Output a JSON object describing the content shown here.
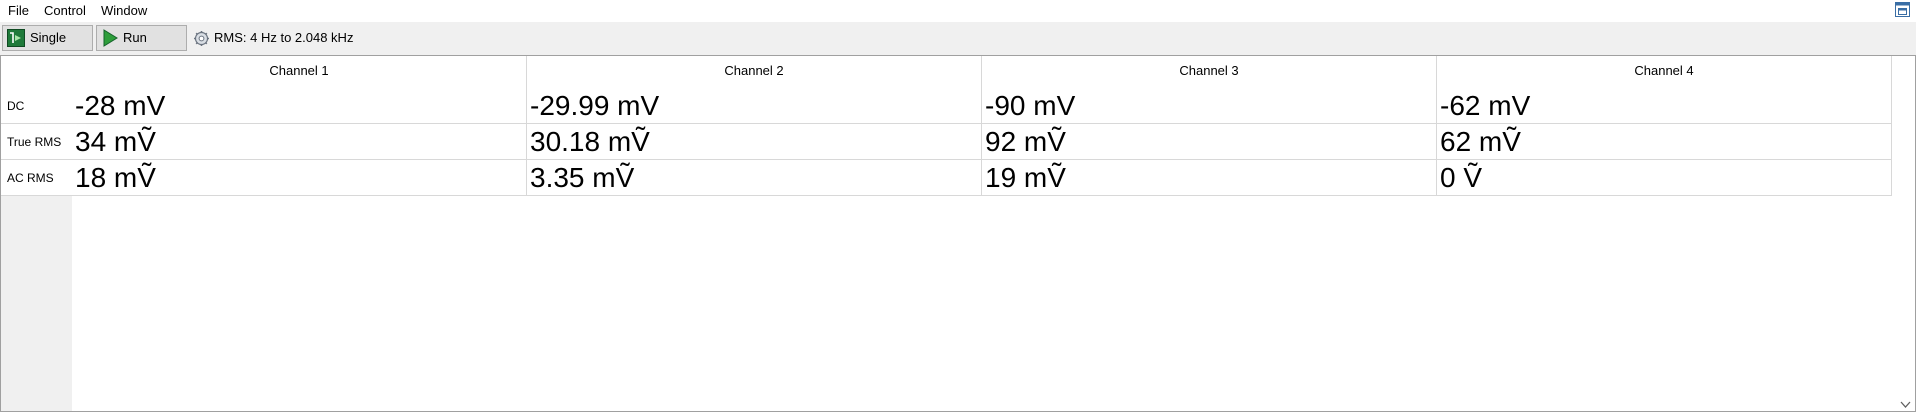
{
  "menu": {
    "file": "File",
    "control": "Control",
    "window": "Window"
  },
  "toolbar": {
    "single_label": "Single",
    "run_label": "Run",
    "rms_range": "RMS: 4 Hz to 2.048 kHz"
  },
  "icons": {
    "restore": "restore-window-icon",
    "single": "single-capture-icon",
    "run": "play-icon",
    "rms": "gear-icon",
    "scroll_down": "chevron-down-icon"
  },
  "colors": {
    "run_accent": "#2e9e3b",
    "single_accent": "#1f7a3a"
  },
  "table": {
    "columns": [
      "Channel 1",
      "Channel 2",
      "Channel 3",
      "Channel 4"
    ],
    "rows": [
      {
        "label": "DC",
        "values": [
          "-28 mV",
          "-29.99 mV",
          "-90 mV",
          "-62 mV"
        ]
      },
      {
        "label": "True RMS",
        "values": [
          "34 mṼ",
          "30.18 mṼ",
          "92 mṼ",
          "62 mṼ"
        ]
      },
      {
        "label": "AC RMS",
        "values": [
          "18 mṼ",
          "3.35 mṼ",
          "19 mṼ",
          "0 Ṽ"
        ]
      }
    ]
  }
}
